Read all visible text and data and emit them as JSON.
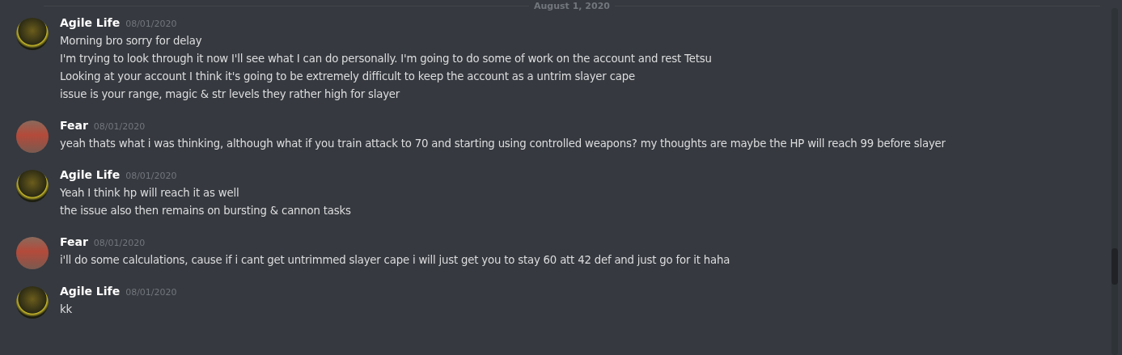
{
  "date_divider": "August 1, 2020",
  "messages": [
    {
      "author": "Agile Life",
      "timestamp": "08/01/2020",
      "avatar": {
        "kind": "logo"
      },
      "lines": [
        "Morning bro sorry for delay",
        "I'm trying to look through it now I'll see what I can do personally. I'm going to do some of work on the account and rest Tetsu",
        "Looking at your account I think it's going to be extremely difficult to keep the account as a untrim slayer cape",
        "issue is your range, magic & str levels they rather high for slayer"
      ]
    },
    {
      "author": "Fear",
      "timestamp": "08/01/2020",
      "avatar": {
        "kind": "photo"
      },
      "lines": [
        "yeah thats what i was thinking, although what if you train attack to 70 and starting using controlled weapons? my thoughts are maybe the HP will reach 99 before slayer"
      ]
    },
    {
      "author": "Agile Life",
      "timestamp": "08/01/2020",
      "avatar": {
        "kind": "logo"
      },
      "lines": [
        "Yeah I think hp will reach it as well",
        "the issue also then remains on bursting & cannon tasks"
      ]
    },
    {
      "author": "Fear",
      "timestamp": "08/01/2020",
      "avatar": {
        "kind": "photo"
      },
      "lines": [
        "i'll do some calculations, cause if i cant get untrimmed slayer cape i will just get you to stay 60 att 42 def and just go for it haha"
      ]
    },
    {
      "author": "Agile Life",
      "timestamp": "08/01/2020",
      "avatar": {
        "kind": "logo"
      },
      "lines": [
        "kk"
      ]
    }
  ]
}
